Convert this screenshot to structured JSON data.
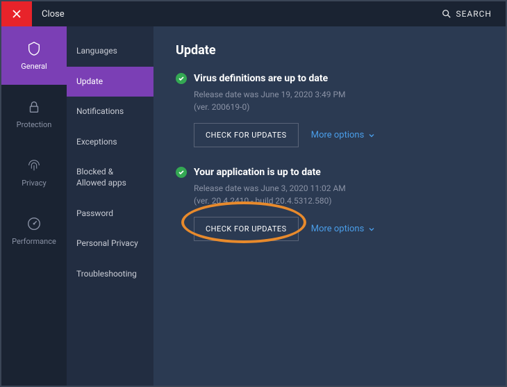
{
  "topbar": {
    "close_label": "Close",
    "search_label": "SEARCH"
  },
  "leftnav": [
    {
      "id": "general",
      "label": "General",
      "active": true
    },
    {
      "id": "protection",
      "label": "Protection",
      "active": false
    },
    {
      "id": "privacy",
      "label": "Privacy",
      "active": false
    },
    {
      "id": "performance",
      "label": "Performance",
      "active": false
    }
  ],
  "subnav": [
    {
      "id": "languages",
      "label": "Languages",
      "active": false
    },
    {
      "id": "update",
      "label": "Update",
      "active": true
    },
    {
      "id": "notifications",
      "label": "Notifications",
      "active": false
    },
    {
      "id": "exceptions",
      "label": "Exceptions",
      "active": false
    },
    {
      "id": "blocked",
      "label": "Blocked & Allowed apps",
      "active": false
    },
    {
      "id": "password",
      "label": "Password",
      "active": false
    },
    {
      "id": "personal",
      "label": "Personal Privacy",
      "active": false
    },
    {
      "id": "troubleshooting",
      "label": "Troubleshooting",
      "active": false
    }
  ],
  "page": {
    "title": "Update",
    "sections": [
      {
        "title": "Virus definitions are up to date",
        "sub1": "Release date was June 19, 2020 3:49 PM",
        "sub2": "(ver. 200619-0)",
        "button": "CHECK FOR UPDATES",
        "more": "More options",
        "highlighted": false
      },
      {
        "title": "Your application is up to date",
        "sub1": "Release date was June 3, 2020 11:02 AM",
        "sub2": "(ver. 20.4.2410 - build 20.4.5312.580)",
        "button": "CHECK FOR UPDATES",
        "more": "More options",
        "highlighted": true
      }
    ]
  }
}
